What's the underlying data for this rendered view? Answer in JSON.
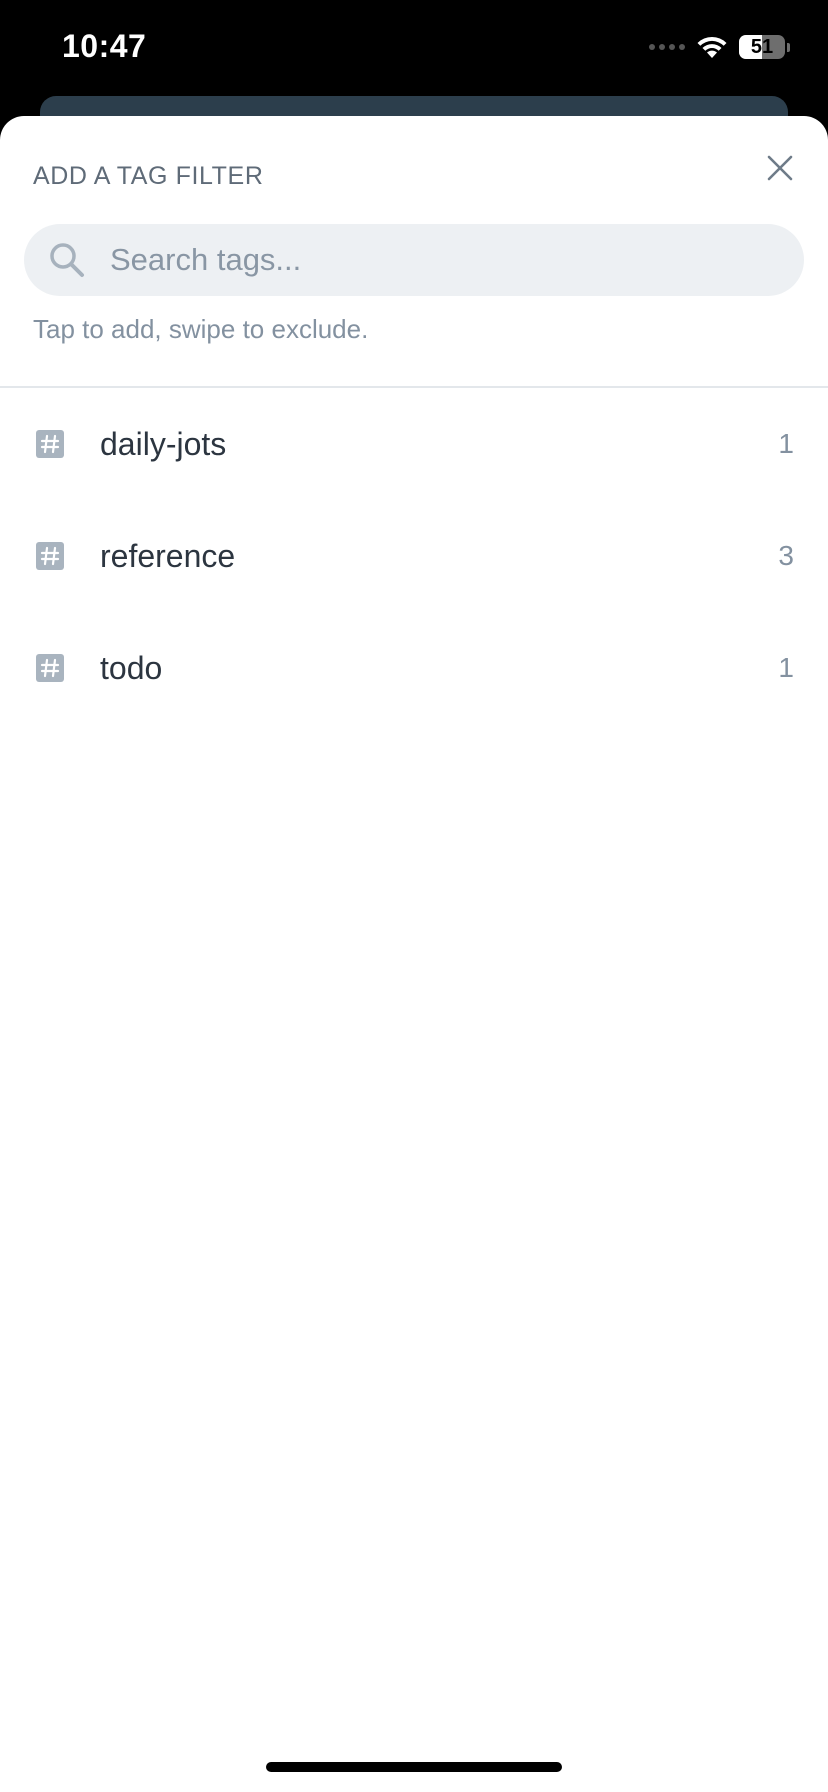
{
  "status_bar": {
    "time": "10:47",
    "battery": "51",
    "battery_level": 0.51
  },
  "sheet": {
    "title": "ADD A TAG FILTER",
    "search_placeholder": "Search tags...",
    "hint": "Tap to add, swipe to exclude."
  },
  "tags": [
    {
      "label": "daily-jots",
      "count": "1",
      "icon": "hashtag-icon"
    },
    {
      "label": "reference",
      "count": "3",
      "icon": "hashtag-icon"
    },
    {
      "label": "todo",
      "count": "1",
      "icon": "hashtag-icon"
    }
  ],
  "colors": {
    "title": "#5f6b78",
    "search_bg": "#edf0f3",
    "tag_icon": "#a9b4bf",
    "behind_card": "#2c3e4c"
  }
}
